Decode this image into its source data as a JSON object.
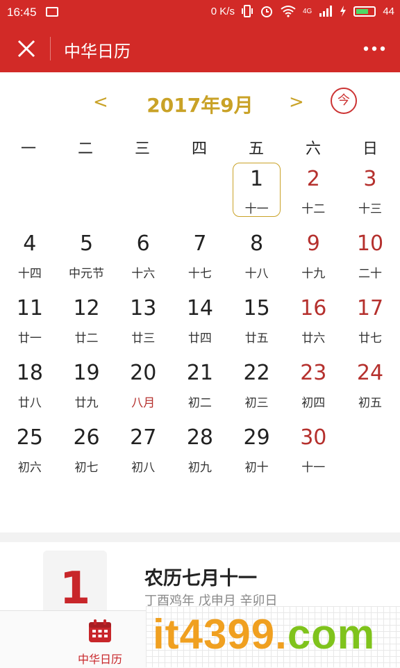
{
  "status_bar": {
    "time": "16:45",
    "net_speed": "0 K/s",
    "network": "4G",
    "battery": "44"
  },
  "app_bar": {
    "title": "中华日历"
  },
  "calendar": {
    "prev_label": "<",
    "next_label": ">",
    "month_label": "2017年9月",
    "today_label": "今",
    "weekdays": [
      "一",
      "二",
      "三",
      "四",
      "五",
      "六",
      "日"
    ],
    "weeks": [
      [
        {
          "day": "",
          "lunar": ""
        },
        {
          "day": "",
          "lunar": ""
        },
        {
          "day": "",
          "lunar": ""
        },
        {
          "day": "",
          "lunar": ""
        },
        {
          "day": "1",
          "lunar": "十一",
          "selected": true
        },
        {
          "day": "2",
          "lunar": "十二",
          "weekend": true
        },
        {
          "day": "3",
          "lunar": "十三",
          "weekend": true
        }
      ],
      [
        {
          "day": "4",
          "lunar": "十四"
        },
        {
          "day": "5",
          "lunar": "中元节"
        },
        {
          "day": "6",
          "lunar": "十六"
        },
        {
          "day": "7",
          "lunar": "十七"
        },
        {
          "day": "8",
          "lunar": "十八"
        },
        {
          "day": "9",
          "lunar": "十九",
          "weekend": true
        },
        {
          "day": "10",
          "lunar": "二十",
          "weekend": true
        }
      ],
      [
        {
          "day": "11",
          "lunar": "廿一"
        },
        {
          "day": "12",
          "lunar": "廿二"
        },
        {
          "day": "13",
          "lunar": "廿三"
        },
        {
          "day": "14",
          "lunar": "廿四"
        },
        {
          "day": "15",
          "lunar": "廿五"
        },
        {
          "day": "16",
          "lunar": "廿六",
          "weekend": true
        },
        {
          "day": "17",
          "lunar": "廿七",
          "weekend": true
        }
      ],
      [
        {
          "day": "18",
          "lunar": "廿八"
        },
        {
          "day": "19",
          "lunar": "廿九"
        },
        {
          "day": "20",
          "lunar": "八月",
          "month_start": true
        },
        {
          "day": "21",
          "lunar": "初二"
        },
        {
          "day": "22",
          "lunar": "初三"
        },
        {
          "day": "23",
          "lunar": "初四",
          "weekend": true
        },
        {
          "day": "24",
          "lunar": "初五",
          "weekend": true
        }
      ],
      [
        {
          "day": "25",
          "lunar": "初六"
        },
        {
          "day": "26",
          "lunar": "初七"
        },
        {
          "day": "27",
          "lunar": "初八"
        },
        {
          "day": "28",
          "lunar": "初九"
        },
        {
          "day": "29",
          "lunar": "初十"
        },
        {
          "day": "30",
          "lunar": "十一",
          "weekend": true
        },
        {
          "day": "",
          "lunar": ""
        }
      ]
    ]
  },
  "detail": {
    "day": "1",
    "lunar_title": "农历七月十一",
    "ganzhi": "丁酉鸡年 戊申月 辛卯日"
  },
  "tab_bar": {
    "calendar_label": "中华日历"
  },
  "watermark": {
    "it": "it",
    "num": "4399",
    "dot": ".",
    "com": "com"
  },
  "colors": {
    "brand_red": "#d22a27",
    "gold": "#c9a227",
    "weekend_red": "#b5302d"
  },
  "icons": [
    "image-icon",
    "close-icon",
    "more-icon",
    "today-icon",
    "calendar-tab-icon"
  ]
}
